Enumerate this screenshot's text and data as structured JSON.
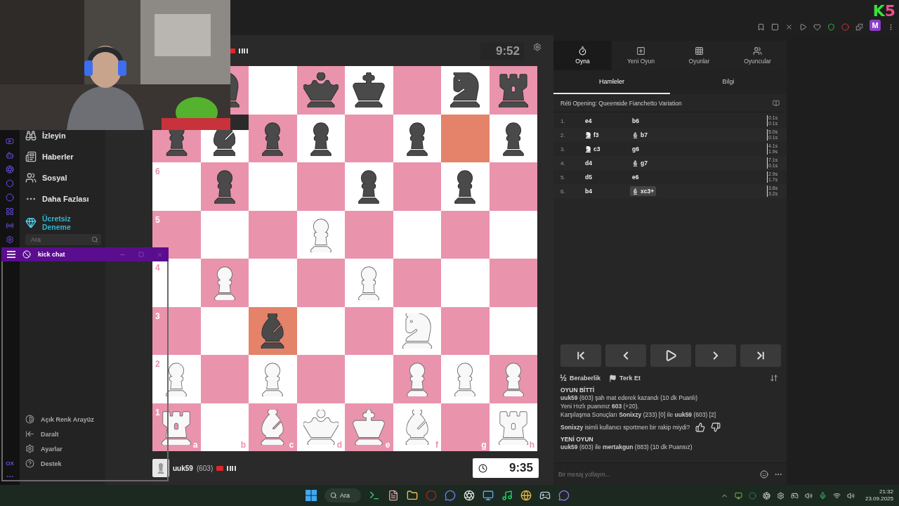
{
  "top_bar": {
    "logo": [
      "K",
      "5"
    ],
    "avatar": "M"
  },
  "opponent": {
    "clock": "9:52"
  },
  "board": {
    "ranks": [
      {
        "cells": [
          null,
          {
            "kind": "knight",
            "white": false,
            "highlighted": false
          },
          {
            "kind": "empty",
            "highlighted": false
          },
          {
            "kind": "queen",
            "white": false,
            "highlighted": false
          },
          {
            "kind": "king",
            "white": false,
            "highlighted": false
          },
          {
            "kind": "empty",
            "highlighted": false
          },
          {
            "kind": "knight",
            "white": false,
            "highlighted": false
          },
          {
            "kind": "rook",
            "white": false,
            "highlighted": false
          }
        ]
      },
      {
        "cells": [
          {
            "kind": "pawn",
            "white": false,
            "highlighted": false
          },
          {
            "kind": "bishop",
            "white": false,
            "highlighted": false
          },
          {
            "kind": "pawn",
            "white": false,
            "highlighted": false
          },
          {
            "kind": "pawn",
            "white": false,
            "highlighted": false
          },
          {
            "kind": "empty",
            "highlighted": false
          },
          {
            "kind": "pawn",
            "white": false,
            "highlighted": false
          },
          {
            "kind": "empty",
            "highlighted": true
          },
          {
            "kind": "pawn",
            "white": false,
            "highlighted": false
          }
        ]
      },
      {
        "label": "6",
        "cells": [
          {
            "kind": "empty",
            "highlighted": false
          },
          {
            "kind": "pawn",
            "white": false,
            "highlighted": false
          },
          {
            "kind": "empty",
            "highlighted": false
          },
          {
            "kind": "empty",
            "highlighted": false
          },
          {
            "kind": "pawn",
            "white": false,
            "highlighted": false
          },
          {
            "kind": "empty",
            "highlighted": false
          },
          {
            "kind": "pawn",
            "white": false,
            "highlighted": false
          },
          {
            "kind": "empty",
            "highlighted": false
          }
        ]
      },
      {
        "label": "5",
        "cells": [
          {
            "kind": "empty",
            "highlighted": false
          },
          {
            "kind": "empty",
            "highlighted": false
          },
          {
            "kind": "empty",
            "highlighted": false
          },
          {
            "kind": "pawn",
            "white": true,
            "highlighted": false
          },
          {
            "kind": "empty",
            "highlighted": false
          },
          {
            "kind": "empty",
            "highlighted": false
          },
          {
            "kind": "empty",
            "highlighted": false
          },
          {
            "kind": "empty",
            "highlighted": false
          }
        ]
      },
      {
        "label": "4",
        "cells": [
          {
            "kind": "empty",
            "highlighted": false
          },
          {
            "kind": "pawn",
            "white": true,
            "highlighted": false
          },
          {
            "kind": "empty",
            "highlighted": false
          },
          {
            "kind": "empty",
            "highlighted": false
          },
          {
            "kind": "pawn",
            "white": true,
            "highlighted": false
          },
          {
            "kind": "empty",
            "highlighted": false
          },
          {
            "kind": "empty",
            "highlighted": false
          },
          {
            "kind": "empty",
            "highlighted": false
          }
        ]
      },
      {
        "label": "3",
        "cells": [
          {
            "kind": "empty",
            "highlighted": false
          },
          {
            "kind": "empty",
            "highlighted": false
          },
          {
            "kind": "bishop",
            "white": false,
            "highlighted": true
          },
          {
            "kind": "empty",
            "highlighted": false
          },
          {
            "kind": "empty",
            "highlighted": false
          },
          {
            "kind": "knight",
            "white": true,
            "highlighted": false
          },
          {
            "kind": "empty",
            "highlighted": false
          },
          {
            "kind": "empty",
            "highlighted": false
          }
        ]
      },
      {
        "label": "2",
        "cells": [
          {
            "kind": "pawn",
            "white": true,
            "highlighted": false
          },
          {
            "kind": "empty",
            "highlighted": false
          },
          {
            "kind": "pawn",
            "white": true,
            "highlighted": false
          },
          {
            "kind": "empty",
            "highlighted": false
          },
          {
            "kind": "empty",
            "highlighted": false
          },
          {
            "kind": "pawn",
            "white": true,
            "highlighted": false
          },
          {
            "kind": "pawn",
            "white": true,
            "highlighted": false
          },
          {
            "kind": "pawn",
            "white": true,
            "highlighted": false
          }
        ]
      },
      {
        "label": "1",
        "cells": [
          {
            "kind": "rook",
            "white": true,
            "highlighted": false
          },
          {
            "kind": "empty",
            "highlighted": false
          },
          {
            "kind": "bishop",
            "white": true,
            "highlighted": false
          },
          {
            "kind": "queen",
            "white": true,
            "highlighted": false
          },
          {
            "kind": "king",
            "white": true,
            "highlighted": false
          },
          {
            "kind": "bishop",
            "white": true,
            "highlighted": false
          },
          {
            "kind": "empty",
            "highlighted": false
          },
          {
            "kind": "rook",
            "white": true,
            "highlighted": false
          }
        ]
      }
    ],
    "files": [
      "a",
      "b",
      "c",
      "d",
      "e",
      "f",
      "g",
      "h"
    ]
  },
  "player": {
    "name": "uuk59",
    "rating": "(603)",
    "clock": "9:35"
  },
  "sidebar": {
    "items": [
      "İzleyin",
      "Haberler",
      "Sosyal",
      "Daha Fazlası"
    ],
    "promo": "Ücretsiz Deneme",
    "search": {
      "placeholder": "Ara"
    },
    "bottom_items": [
      "Açık Renk Arayüz",
      "Daralt",
      "Ayarlar",
      "Destek"
    ],
    "rail_text": "OX"
  },
  "kick_chat": {
    "title": "kick chat"
  },
  "panel": {
    "tabs": [
      {
        "label": "Oyna",
        "selected": true
      },
      {
        "label": "Yeni Oyun",
        "selected": false
      },
      {
        "label": "Oyunlar",
        "selected": false
      },
      {
        "label": "Oyuncular",
        "selected": false
      }
    ],
    "subtabs": [
      {
        "label": "Hamleler",
        "selected": true
      },
      {
        "label": "Bilgi",
        "selected": false
      }
    ],
    "opening": "Réti Opening: Queenside Fianchetto Variation",
    "moves": [
      {
        "number": "1.",
        "white": {
          "text": "e4",
          "selected": false
        },
        "black": {
          "text": "b6",
          "selected": false
        },
        "times": [
          "0.1s",
          "0.1s"
        ]
      },
      {
        "number": "2.",
        "white": {
          "kind": "knight",
          "text": "f3",
          "selected": false
        },
        "black": {
          "kind": "bishop",
          "text": "b7",
          "selected": false
        },
        "times": [
          "5.0s",
          "0.1s"
        ]
      },
      {
        "number": "3.",
        "white": {
          "kind": "knight",
          "text": "c3",
          "selected": false
        },
        "black": {
          "text": "g6",
          "selected": false
        },
        "times": [
          "4.1s",
          "1.9s"
        ]
      },
      {
        "number": "4.",
        "white": {
          "text": "d4",
          "selected": false
        },
        "black": {
          "kind": "bishop",
          "text": "g7",
          "selected": false
        },
        "times": [
          "7.1s",
          "0.1s"
        ]
      },
      {
        "number": "5.",
        "white": {
          "text": "d5",
          "selected": false
        },
        "black": {
          "text": "e6",
          "selected": false
        },
        "times": [
          "2.9s",
          "1.7s"
        ]
      },
      {
        "number": "6.",
        "white": {
          "text": "b4",
          "selected": false
        },
        "black": {
          "kind": "bishop",
          "text": "xc3+",
          "selected": true
        },
        "times": [
          "3.8s",
          "3.2s"
        ]
      }
    ],
    "actions": [
      {
        "kind": "draw",
        "glyph": "½",
        "label": "Beraberlik"
      },
      {
        "kind": "resign",
        "label": "Terk Et"
      }
    ],
    "chat": [
      {
        "kind": "heading",
        "text": "OYUN BİTTİ"
      },
      {
        "kind": "line",
        "text": "**uuk59** (603) şah mat ederek kazandı (10 dk Puanlı)"
      },
      {
        "kind": "line",
        "text": "Yeni Hızlı puanınız **603** (+20)."
      },
      {
        "kind": "line",
        "text": "Karşılaşma Sonuçları **Sonixzy** (233) [0] ile **uuk59** (603) [2]"
      },
      {
        "kind": "question",
        "text": "**Sonixzy** isimli kullanıcı sportmen bir rakip miydi?"
      },
      {
        "kind": "heading",
        "text": "YENİ OYUN"
      },
      {
        "kind": "line",
        "text": "**uuk59** (603) ile **mertakgun** (883) (10 dk Puansız)"
      }
    ],
    "message_field": {
      "placeholder": "Bir mesaj yollayın..."
    }
  },
  "taskbar": {
    "search": "Ara",
    "time": "21:32",
    "date": "23.09.2025"
  }
}
